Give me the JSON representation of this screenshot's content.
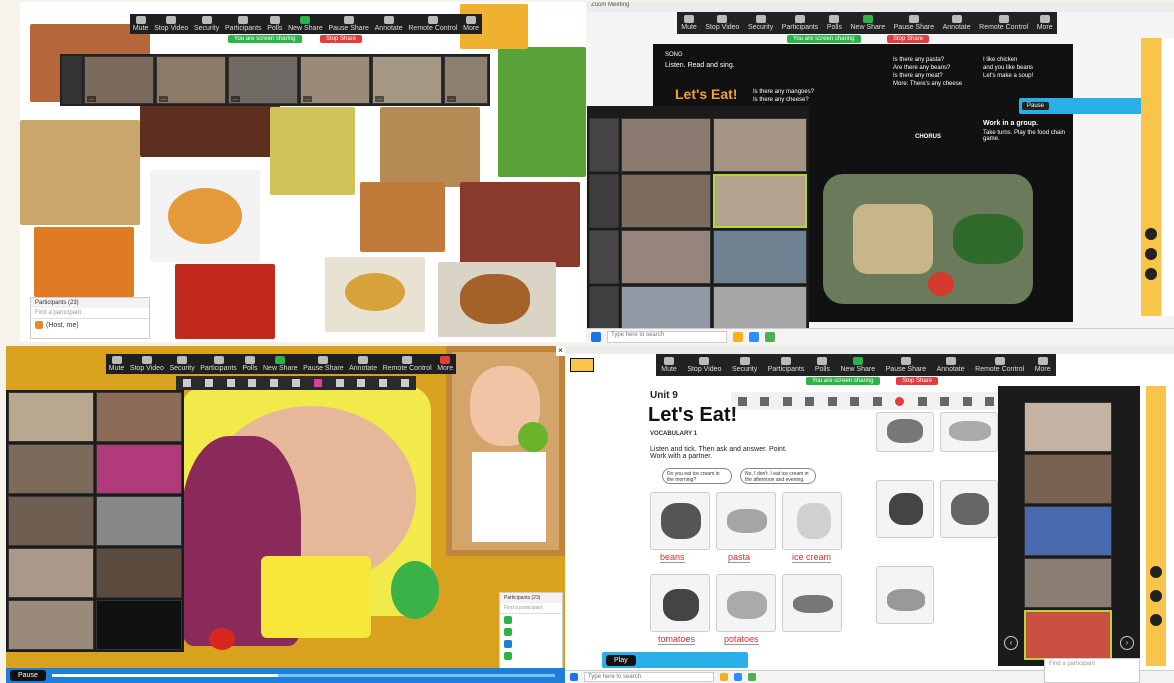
{
  "toolbar": {
    "items": [
      "Mute",
      "Stop Video",
      "Security",
      "Participants",
      "Polls",
      "New Share",
      "Pause Share",
      "Annotate",
      "Remote Control",
      "More"
    ],
    "share_banner": "You are screen sharing",
    "stop_share": "Stop Share"
  },
  "q1": {
    "participants": [
      "…",
      "…",
      "…",
      "…",
      "…",
      "…"
    ],
    "chat": {
      "title": "Participants (23)",
      "search_placeholder": "Find a participant",
      "row1": "(Host, me)"
    }
  },
  "q2": {
    "title": "Zoom Meeting",
    "book": {
      "song": "SONG",
      "listen": "Listen. Read and sing.",
      "title": "Let's Eat!",
      "chorus": "CHORUS",
      "work": "Work in a group.",
      "work_sub": "Take turns. Play the food chain game.",
      "lines": [
        "Is there any pasta?",
        "Are there any beans?",
        "Is there any meat?",
        "More: There's any cheese",
        "Is there any mangoes?",
        "Is there any cheese?",
        "I like chicken",
        "and you like beans",
        "Let's make a soup!"
      ]
    },
    "pause_label": "Pause",
    "taskbar_search": "Type here to search"
  },
  "q3": {
    "pause_label": "Pause",
    "panel_title": "Participants (23)",
    "panel_search": "Find a participant"
  },
  "q4": {
    "unit": "Unit 9",
    "title": "Let's Eat!",
    "vocab": "VOCABULARY 1",
    "instruction": "Listen and tick. Then ask and answer. Point.",
    "instruction2": "Work with a partner.",
    "bubble1": "Do you eat ice cream in the morning?",
    "bubble2": "No, I don't. I eat ice cream in the afternoon and evening.",
    "words": [
      "beans",
      "pasta",
      "ice cream",
      "tomatoes",
      "potatoes"
    ],
    "play_label": "Play",
    "search": "Type here to search",
    "participant_search": "Find a participant"
  },
  "colors": {
    "accent_green": "#2cb34a",
    "stop_red": "#e23c3c",
    "zoom_blue": "#1d7fd8",
    "side_yellow": "#f8c44a"
  }
}
